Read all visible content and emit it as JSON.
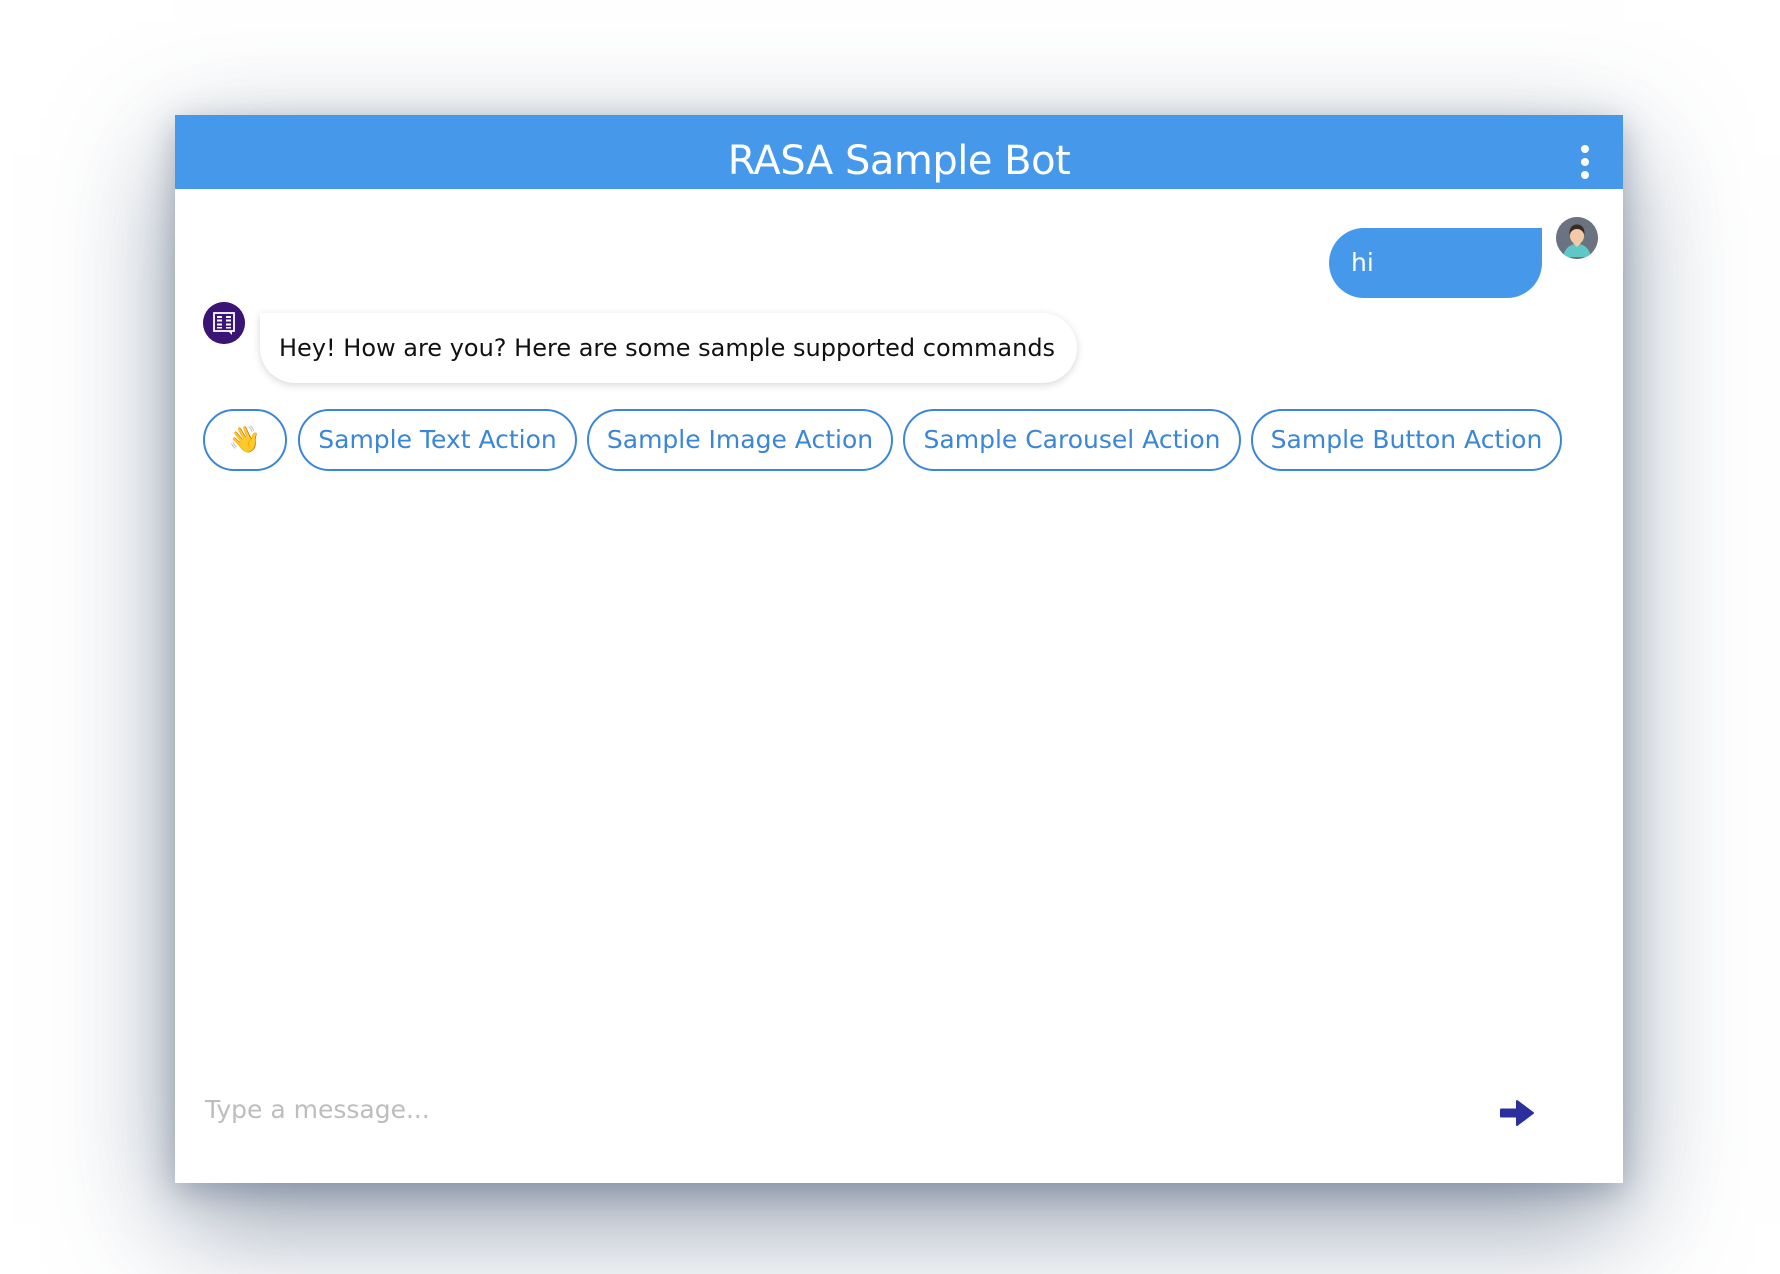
{
  "window": {
    "title": "RASA Sample Bot",
    "menu_icon": "more-vertical-icon"
  },
  "colors": {
    "header": "#4699ea",
    "user_bubble": "#4699ea",
    "quick_reply_accent": "#3a86d8",
    "send_icon": "#2b2f9e",
    "bot_avatar": "#3b1576"
  },
  "conversation": {
    "messages": [
      {
        "sender": "user",
        "text": "hi",
        "avatar_icon": "user-avatar-icon"
      },
      {
        "sender": "bot",
        "text": "Hey! How are you? Here are some sample supported commands",
        "avatar_icon": "rasa-bot-avatar-icon"
      }
    ]
  },
  "quick_replies": [
    {
      "label": "👋"
    },
    {
      "label": "Sample Text Action"
    },
    {
      "label": "Sample Image Action"
    },
    {
      "label": "Sample Carousel Action"
    },
    {
      "label": "Sample Button Action"
    }
  ],
  "composer": {
    "placeholder": "Type a message...",
    "value": "",
    "send_icon": "send-arrow-icon"
  }
}
